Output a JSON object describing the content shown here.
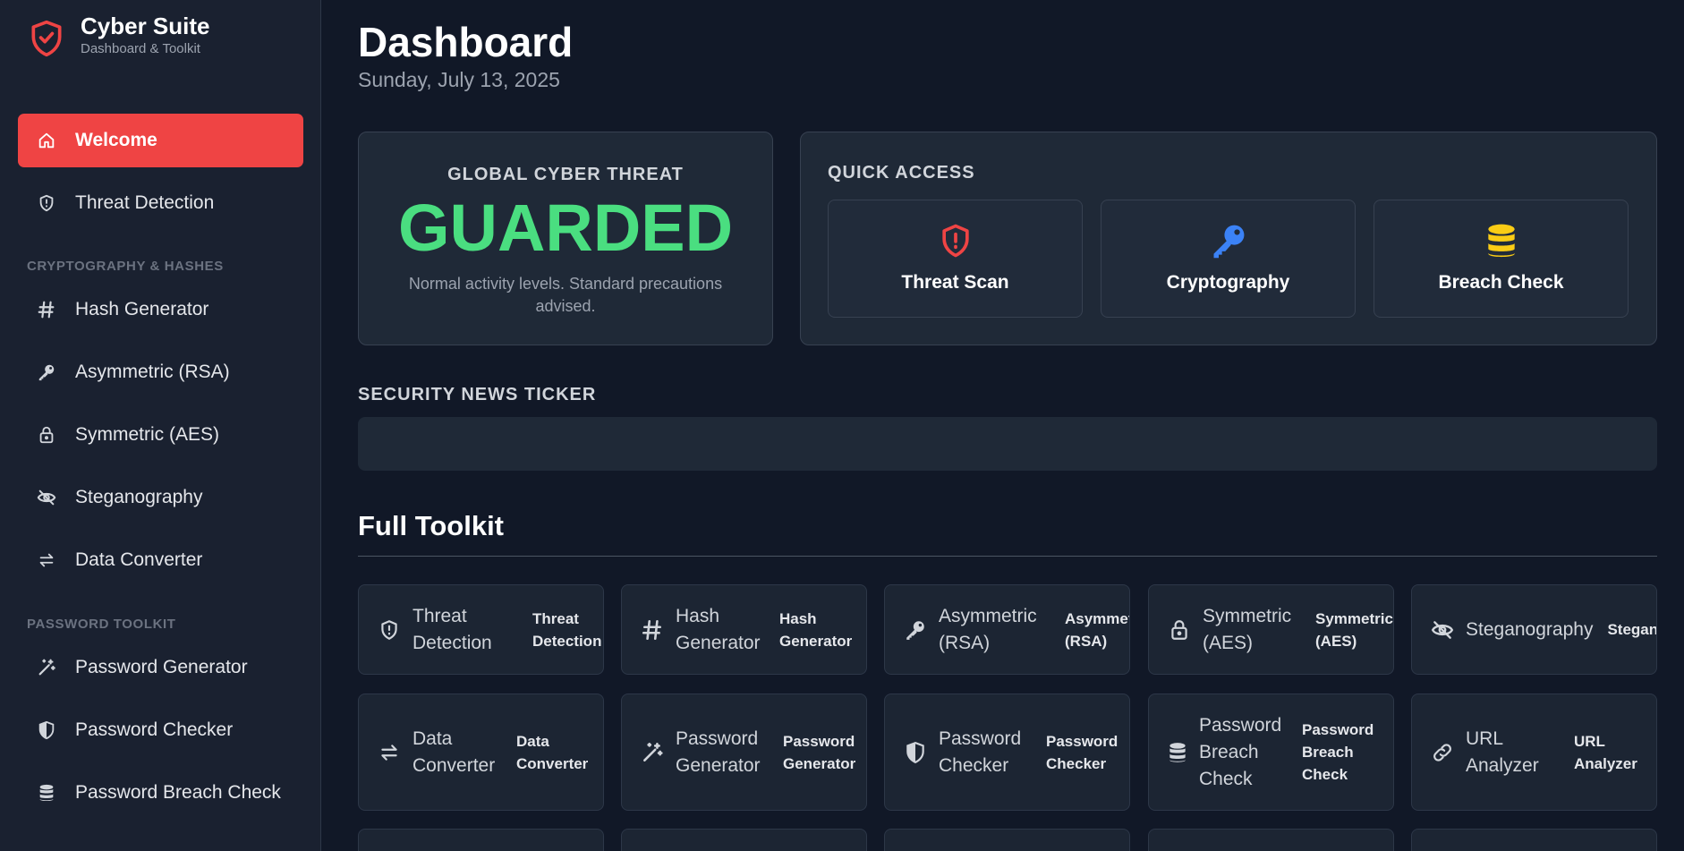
{
  "brand": {
    "title": "Cyber Suite",
    "subtitle": "Dashboard & Toolkit"
  },
  "sidebar": {
    "items": [
      {
        "label": "Welcome",
        "icon": "home-icon",
        "active": true
      },
      {
        "label": "Threat Detection",
        "icon": "shield-alert-icon"
      }
    ],
    "sections": [
      {
        "title": "CRYPTOGRAPHY & HASHES",
        "items": [
          {
            "label": "Hash Generator",
            "icon": "hash-icon"
          },
          {
            "label": "Asymmetric (RSA)",
            "icon": "key-icon"
          },
          {
            "label": "Symmetric (AES)",
            "icon": "lock-icon"
          },
          {
            "label": "Steganography",
            "icon": "eye-off-icon"
          },
          {
            "label": "Data Converter",
            "icon": "arrows-swap-icon"
          }
        ]
      },
      {
        "title": "PASSWORD TOOLKIT",
        "items": [
          {
            "label": "Password Generator",
            "icon": "magic-wand-icon"
          },
          {
            "label": "Password Checker",
            "icon": "shield-half-icon"
          },
          {
            "label": "Password Breach Check",
            "icon": "database-icon"
          }
        ]
      }
    ]
  },
  "header": {
    "title": "Dashboard",
    "date": "Sunday, July 13, 2025"
  },
  "threat": {
    "label": "GLOBAL CYBER THREAT",
    "level": "GUARDED",
    "description": "Normal activity levels. Standard precautions advised.",
    "level_color": "#4ade80"
  },
  "quick_access": {
    "title": "QUICK ACCESS",
    "items": [
      {
        "label": "Threat Scan",
        "icon": "shield-alert-icon",
        "color": "#ef4444"
      },
      {
        "label": "Cryptography",
        "icon": "key-icon",
        "color": "#3b82f6"
      },
      {
        "label": "Breach Check",
        "icon": "database-icon",
        "color": "#facc15"
      }
    ]
  },
  "ticker": {
    "title": "SECURITY NEWS TICKER",
    "text": ""
  },
  "toolkit": {
    "title": "Full Toolkit",
    "tools": [
      {
        "name": "Threat Detection",
        "sub": "Threat Detection",
        "icon": "shield-alert-icon"
      },
      {
        "name": "Hash Generator",
        "sub": "Hash Generator",
        "icon": "hash-icon"
      },
      {
        "name": "Asymmetric (RSA)",
        "sub": "Asymmetric (RSA)",
        "icon": "key-icon"
      },
      {
        "name": "Symmetric (AES)",
        "sub": "Symmetric (AES)",
        "icon": "lock-icon"
      },
      {
        "name": "Steganography",
        "sub": "Steganog",
        "icon": "eye-off-icon"
      },
      {
        "name": "Data Converter",
        "sub": "Data Converter",
        "icon": "arrows-swap-icon"
      },
      {
        "name": "Password Generator",
        "sub": "Password Generator",
        "icon": "magic-wand-icon"
      },
      {
        "name": "Password Checker",
        "sub": "Password Checker",
        "icon": "shield-half-icon"
      },
      {
        "name": "Password Breach Check",
        "sub": "Password Breach Check",
        "icon": "database-icon"
      },
      {
        "name": "URL Analyzer",
        "sub": "URL Analyzer",
        "icon": "link-icon"
      }
    ]
  },
  "colors": {
    "accent": "#ef4444",
    "background": "#111827",
    "sidebar": "#1a2130"
  }
}
